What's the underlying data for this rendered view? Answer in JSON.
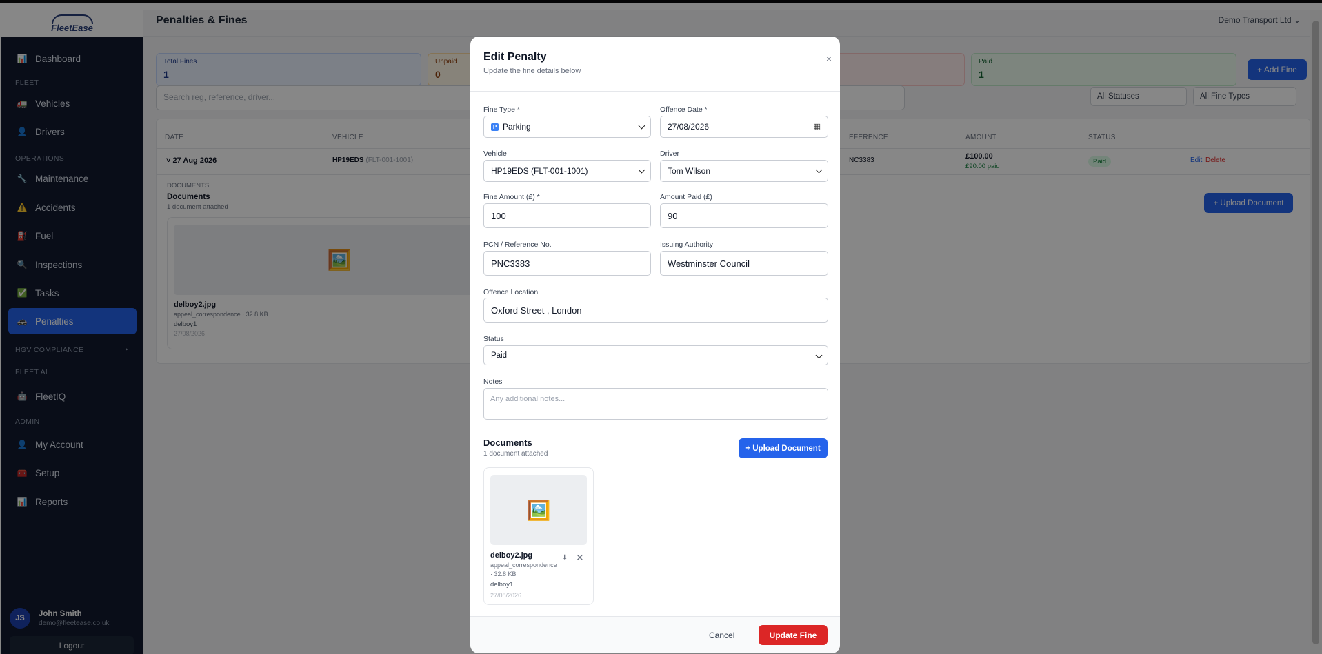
{
  "app": {
    "brand": "FleetEase",
    "org": "Demo Transport Ltd",
    "page_title": "Penalties & Fines"
  },
  "sidebar": {
    "items": [
      {
        "label": "Dashboard",
        "icon": "dashboard-icon"
      },
      {
        "label": "Vehicles",
        "icon": "truck-icon"
      },
      {
        "label": "Drivers",
        "icon": "person-icon"
      },
      {
        "label": "Maintenance",
        "icon": "wrench-icon"
      },
      {
        "label": "Accidents",
        "icon": "warning-icon"
      },
      {
        "label": "Fuel",
        "icon": "fuel-icon"
      },
      {
        "label": "Inspections",
        "icon": "magnifier-icon"
      },
      {
        "label": "Tasks",
        "icon": "checkbox-icon"
      },
      {
        "label": "Penalties",
        "icon": "police-car-icon"
      },
      {
        "label": "FleetIQ",
        "icon": "robot-icon"
      },
      {
        "label": "My Account",
        "icon": "person-icon"
      },
      {
        "label": "Setup",
        "icon": "toolbox-icon"
      },
      {
        "label": "Reports",
        "icon": "chart-icon"
      }
    ],
    "sections": {
      "fleet": "FLEET",
      "operations": "OPERATIONS",
      "hgv": "HGV COMPLIANCE",
      "fleet_ai": "FLEET AI",
      "admin": "ADMIN"
    },
    "user": {
      "initials": "JS",
      "name": "John Smith",
      "email": "demo@fleetease.co.uk"
    },
    "logout": "Logout"
  },
  "stats": {
    "total": {
      "label": "Total Fines",
      "value": "1"
    },
    "unpaid": {
      "label": "Unpaid",
      "value": "0"
    },
    "paid": {
      "label": "Paid",
      "value": "1"
    }
  },
  "toolbar": {
    "add_fine": "+ Add Fine",
    "search_placeholder": "Search reg, reference, driver...",
    "status_filter": "All Statuses",
    "type_filter": "All Fine Types"
  },
  "table": {
    "headers": {
      "date": "DATE",
      "vehicle": "VEHICLE",
      "reference": "EFERENCE",
      "amount": "AMOUNT",
      "status": "STATUS"
    },
    "row": {
      "date": "27 Aug 2026",
      "vehicle_reg": "HP19EDS",
      "vehicle_id": "(FLT-001-1001)",
      "reference": "NC3383",
      "amount": "£100.00",
      "paid": "£90.00 paid",
      "status": "Paid",
      "edit": "Edit",
      "delete": "Delete"
    },
    "docs": {
      "section": "DOCUMENTS",
      "title": "Documents",
      "count": "1 document attached",
      "upload": "+ Upload Document",
      "file": "delboy2.jpg",
      "meta": "appeal_correspondence · 32.8 KB",
      "user": "delboy1",
      "date": "27/08/2026"
    }
  },
  "modal": {
    "title": "Edit Penalty",
    "subtitle": "Update the fine details below",
    "close": "×",
    "fine_type_label": "Fine Type *",
    "fine_type_value": "Parking",
    "offence_date_label": "Offence Date *",
    "offence_date_value": "27/08/2026",
    "vehicle_label": "Vehicle",
    "vehicle_value": "HP19EDS (FLT-001-1001)",
    "driver_label": "Driver",
    "driver_value": "Tom Wilson",
    "fine_amount_label": "Fine Amount (£) *",
    "fine_amount_value": "100",
    "amount_paid_label": "Amount Paid (£)",
    "amount_paid_value": "90",
    "pcn_label": "PCN / Reference No.",
    "pcn_value": "PNC3383",
    "authority_label": "Issuing Authority",
    "authority_value": "Westminster Council",
    "location_label": "Offence Location",
    "location_value": "Oxford Street , London",
    "status_label": "Status",
    "status_value": "Paid",
    "notes_label": "Notes",
    "notes_placeholder": "Any additional notes...",
    "docs_title": "Documents",
    "docs_count": "1 document attached",
    "upload": "+ Upload Document",
    "doc": {
      "name": "delboy2.jpg",
      "category": "appeal_correspondence",
      "size": "· 32.8 KB",
      "user": "delboy1",
      "date": "27/08/2026"
    },
    "cancel": "Cancel",
    "submit": "Update Fine"
  },
  "colors": {
    "primary": "#2563eb",
    "danger": "#dc2626",
    "sidebar": "#111a2e",
    "success": "#15803d"
  }
}
